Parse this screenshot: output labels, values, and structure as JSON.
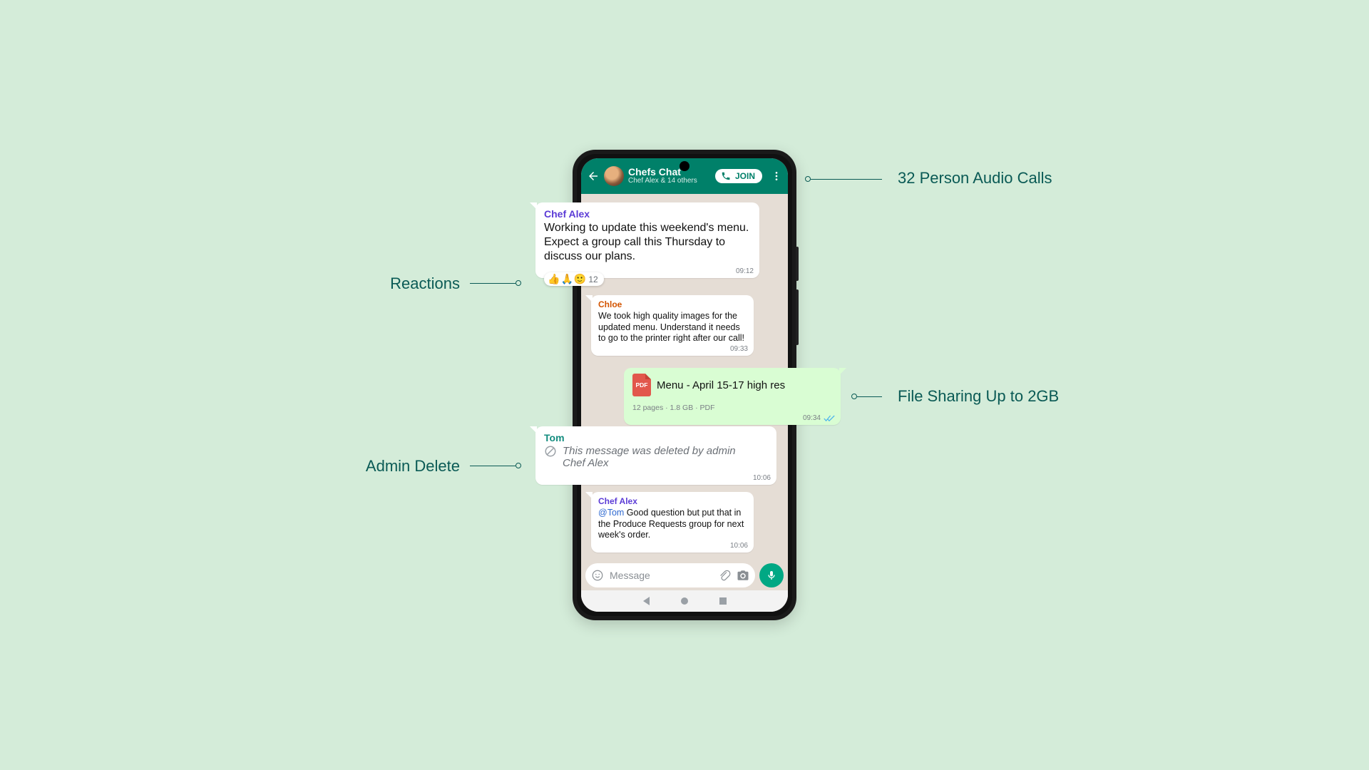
{
  "header": {
    "title": "Chefs Chat",
    "subtitle": "Chef Alex & 14 others",
    "join": "JOIN"
  },
  "callouts": {
    "audio": "32 Person Audio Calls",
    "reactions": "Reactions",
    "file": "File Sharing Up to 2GB",
    "admin_delete": "Admin Delete"
  },
  "messages": {
    "m1": {
      "name": "Chef Alex",
      "body": "Working to update this weekend's menu. Expect a group call this Thursday to discuss our plans.",
      "time": "09:12",
      "reactions": {
        "r1": "👍",
        "r2": "🙏",
        "r3": "🙂",
        "count": "12"
      }
    },
    "m2": {
      "name": "Chloe",
      "body": "We took high quality images for the updated menu. Understand it needs to go to the printer right after our call!",
      "time": "09:33"
    },
    "m3": {
      "badge": "PDF",
      "file_name": "Menu - April 15-17 high res",
      "meta": "12 pages  ·  1.8 GB  ·  PDF",
      "time": "09:34"
    },
    "m4": {
      "name": "Tom",
      "body": "This message was deleted by admin Chef Alex",
      "time": "10:06"
    },
    "m5": {
      "name": "Chef Alex",
      "mention": "@Tom",
      "body": " Good question but put that in the Produce Requests group for next week's order.",
      "time": "10:06"
    }
  },
  "input": {
    "placeholder": "Message"
  },
  "colors": {
    "name_chef_alex": "#5b3bd6",
    "name_chloe": "#d35400",
    "name_tom": "#128c7e"
  }
}
